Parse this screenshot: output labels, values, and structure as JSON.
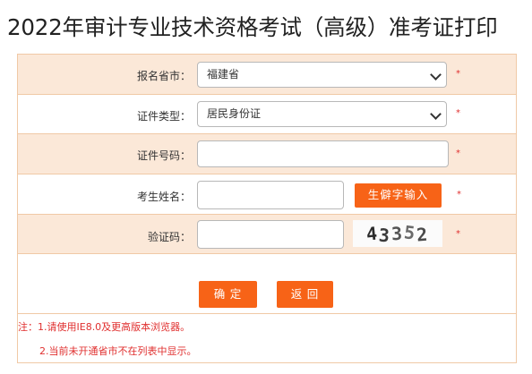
{
  "page": {
    "title": "2022年审计专业技术资格考试（高级）准考证打印"
  },
  "form": {
    "province": {
      "label": "报名省市：",
      "value": "福建省",
      "required": "*"
    },
    "id_type": {
      "label": "证件类型：",
      "value": "居民身份证",
      "required": "*"
    },
    "id_number": {
      "label": "证件号码：",
      "value": "",
      "required": "*"
    },
    "name": {
      "label": "考生姓名：",
      "value": "",
      "button": "生僻字输入",
      "required": "*"
    },
    "captcha": {
      "label": "验证码：",
      "value": "",
      "image_text": "43352",
      "required": "*"
    }
  },
  "actions": {
    "confirm": "确 定",
    "back": "返 回"
  },
  "notes": {
    "line1": "注：1.请使用IE8.0及更高版本浏览器。",
    "line2": "2.当前未开通省市不在列表中显示。"
  },
  "colors": {
    "accent": "#f76317",
    "row_shade": "#fbe8d8",
    "border": "#f0c9a6",
    "required": "#e0302f"
  }
}
